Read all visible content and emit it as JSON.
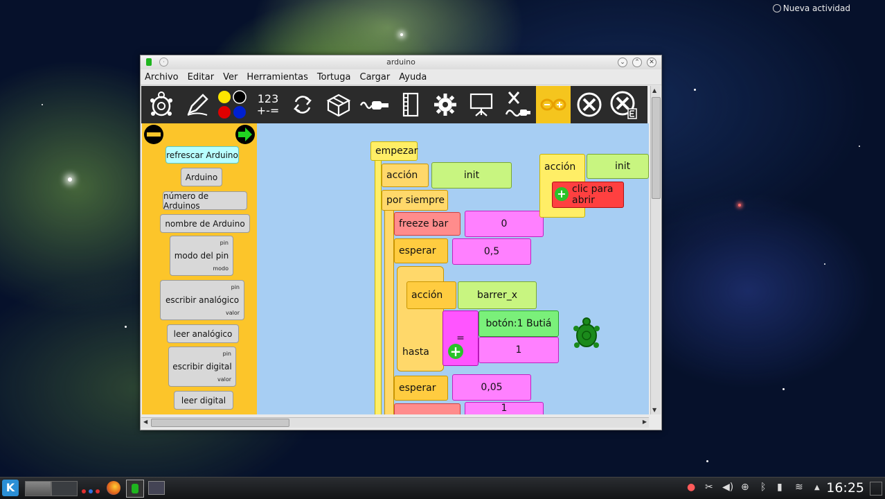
{
  "desktop": {
    "notification": "Nueva actividad"
  },
  "window": {
    "title": "arduino",
    "menu": [
      "Archivo",
      "Editar",
      "Ver",
      "Herramientas",
      "Tortuga",
      "Cargar",
      "Ayuda"
    ]
  },
  "toolbar": {
    "numbers_label_top": "123",
    "numbers_label_bottom": "+-=",
    "tools": [
      "turtle",
      "pen",
      "colors",
      "numbers",
      "flow",
      "boxes",
      "sensors",
      "media",
      "extras",
      "projector",
      "butia",
      "arduino",
      "stop",
      "stop-erase"
    ]
  },
  "palette": {
    "blocks": [
      {
        "label": "refrescar Arduino"
      },
      {
        "label": "Arduino"
      },
      {
        "label": "número de Arduinos"
      },
      {
        "label": "nombre de Arduino"
      },
      {
        "label": "modo del pin",
        "tag1": "pin",
        "tag2": "modo"
      },
      {
        "label": "escribir analógico",
        "tag1": "pin",
        "tag2": "valor"
      },
      {
        "label": "leer analógico"
      },
      {
        "label": "escribir digital",
        "tag1": "pin",
        "tag2": "valor"
      },
      {
        "label": "leer digital"
      }
    ]
  },
  "canvas": {
    "start": "empezar",
    "action1": "acción",
    "init1": "init",
    "forever": "por siempre",
    "freeze_bar": "freeze bar",
    "zero": "0",
    "wait1": "esperar",
    "half": "0,5",
    "action2": "acción",
    "sweep": "barrer_x",
    "until": "hasta",
    "equals": "=",
    "button": "botón:1 Butiá",
    "one": "1",
    "wait2": "esperar",
    "small": "0,05",
    "bottom_val": "1",
    "action3": "acción",
    "init2": "init",
    "click_open": "clic para abrir"
  },
  "taskbar": {
    "clock": "16:25"
  },
  "colors": {
    "palette_bg": "#fcc52a",
    "canvas_bg": "#a7cef3",
    "toolbar_bg": "#2b2b2b",
    "active_tool": "#f5c51e"
  }
}
